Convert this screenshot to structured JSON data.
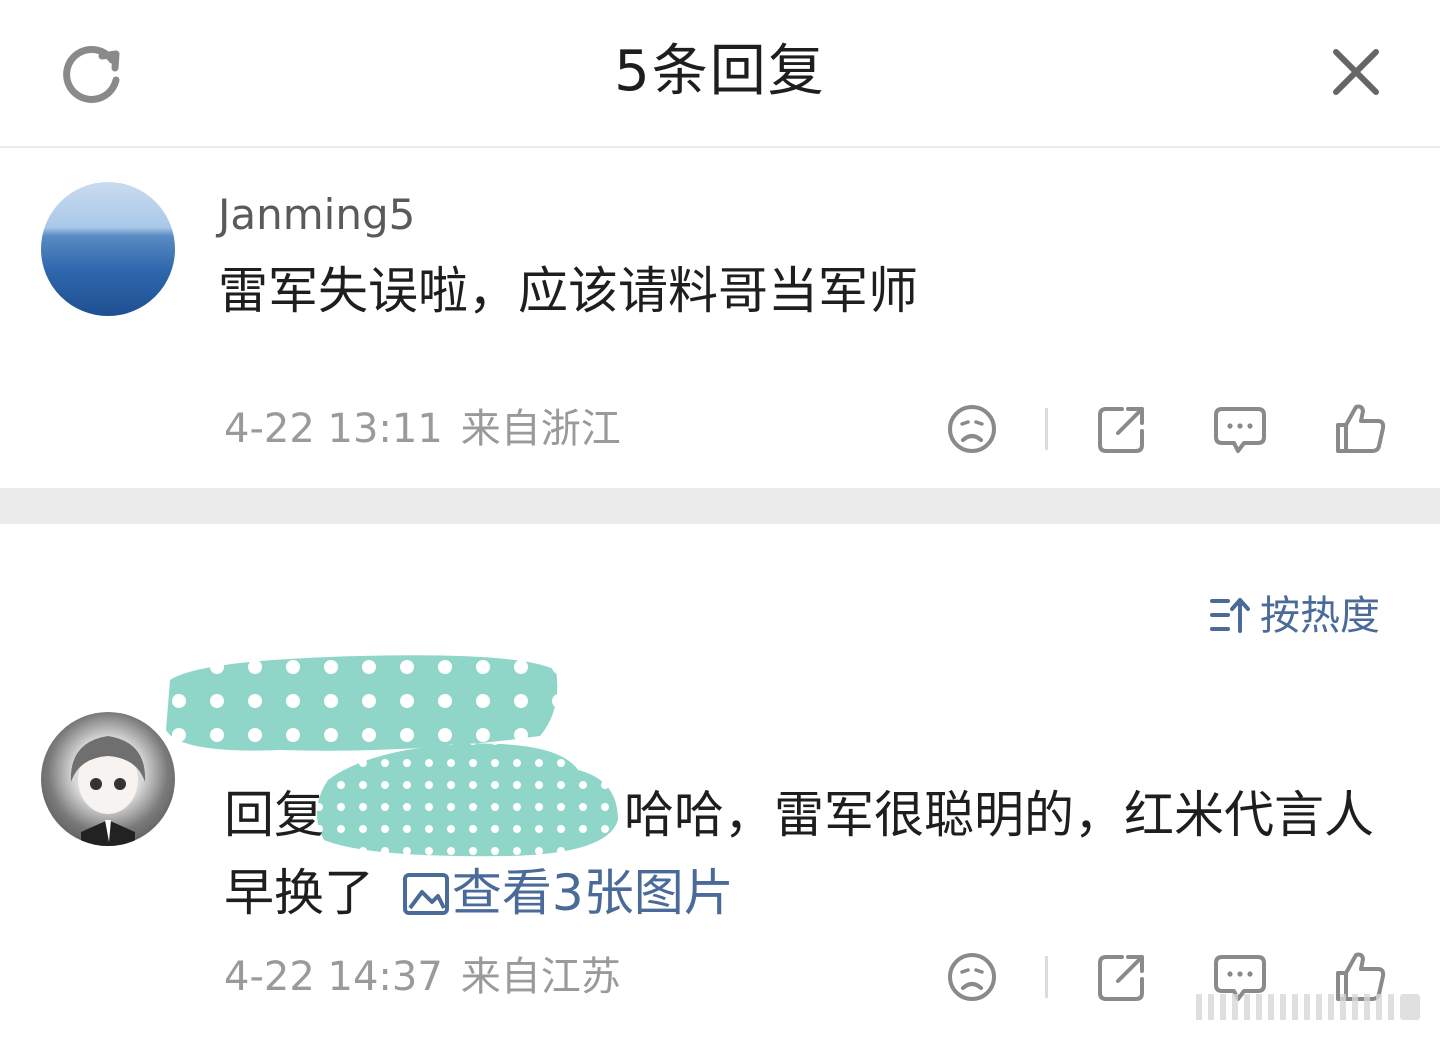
{
  "header": {
    "title": "5条回复"
  },
  "comment": {
    "username": "Janming5",
    "text": "雷军失误啦，应该请料哥当军师",
    "time": "4-22 13:11",
    "location": "来自浙江"
  },
  "sort": {
    "label": "按热度"
  },
  "reply": {
    "prefix": "回复",
    "text": "哈哈，雷军很聪明的，红米代言人早换了",
    "images_link": "查看3张图片",
    "time": "4-22 14:37",
    "location": "来自江苏"
  },
  "colors": {
    "link": "#4a6b9a",
    "redaction": "#8fd6c8",
    "meta": "#9a9a9a"
  },
  "icons": [
    "refresh-icon",
    "close-icon",
    "sad-face-icon",
    "share-icon",
    "comment-icon",
    "thumbs-up-icon",
    "image-icon",
    "sort-icon"
  ]
}
